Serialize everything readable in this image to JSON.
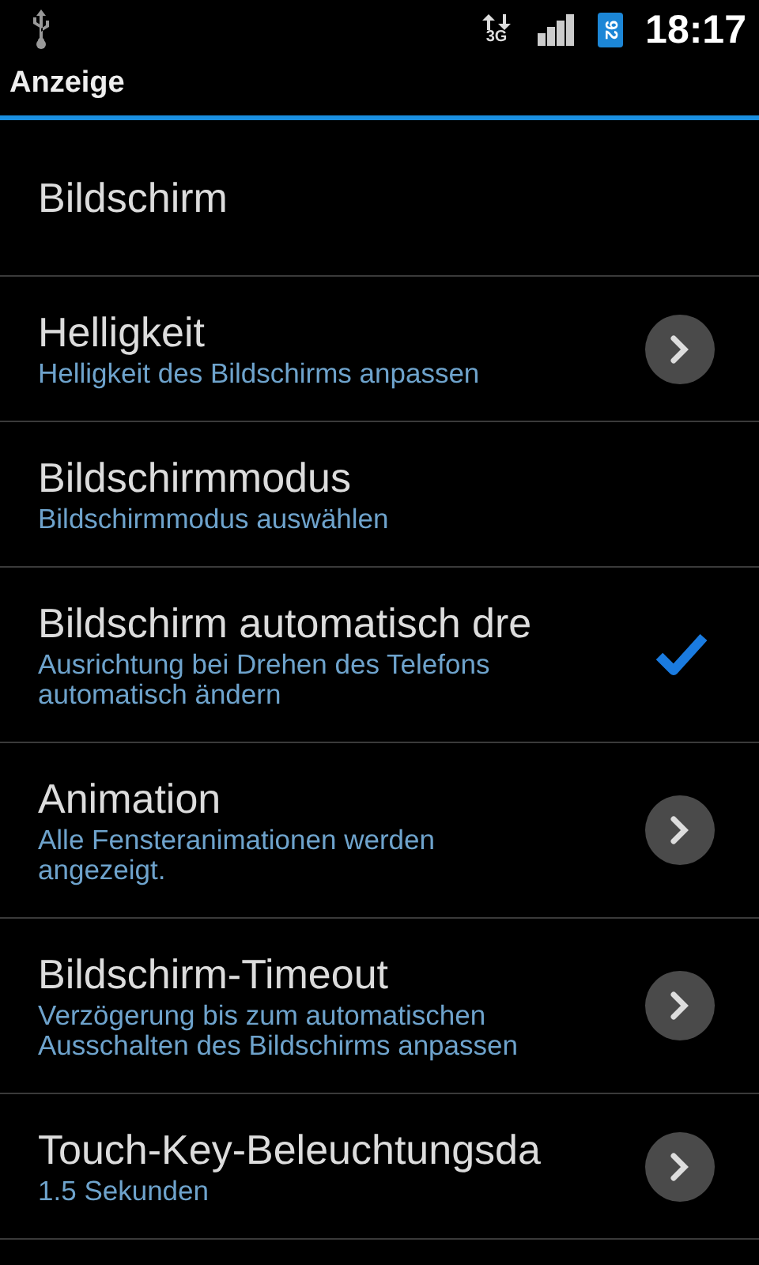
{
  "status_bar": {
    "network": "3G",
    "battery": "92",
    "time": "18:17"
  },
  "window": {
    "title": "Anzeige"
  },
  "items": [
    {
      "kind": "category",
      "title": "Bildschirm"
    },
    {
      "kind": "arrow",
      "title": "Helligkeit",
      "summary": "Helligkeit des Bildschirms anpassen"
    },
    {
      "kind": "plain",
      "title": "Bildschirmmodus",
      "summary": "Bildschirmmodus auswählen"
    },
    {
      "kind": "checkbox",
      "title": "Bildschirm automatisch dre",
      "summary": "Ausrichtung bei Drehen des Telefons automatisch ändern",
      "checked": true
    },
    {
      "kind": "arrow",
      "title": "Animation",
      "summary": "Alle Fensteranimationen werden angezeigt."
    },
    {
      "kind": "arrow",
      "title": "Bildschirm-Timeout",
      "summary": "Verzögerung bis zum automatischen Ausschalten des Bildschirms anpassen"
    },
    {
      "kind": "arrow",
      "title": "Touch-Key-Beleuchtungsda",
      "summary": "1.5 Sekunden"
    }
  ]
}
